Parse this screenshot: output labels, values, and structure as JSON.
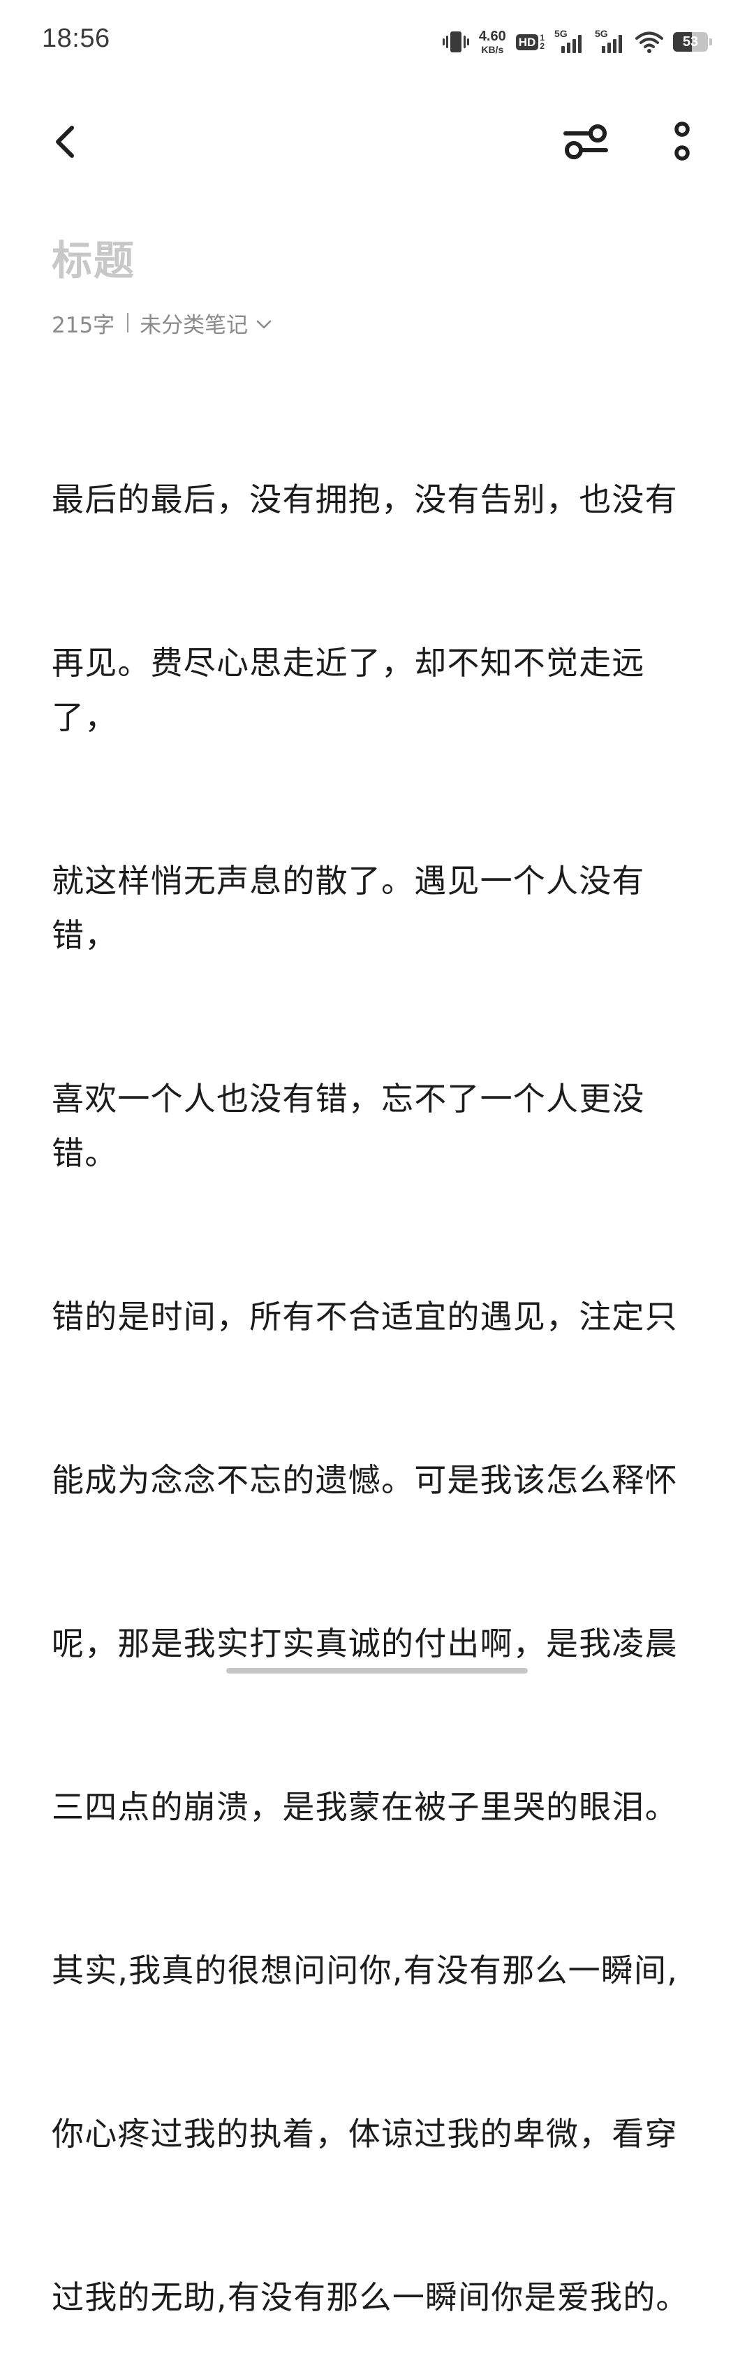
{
  "status_bar": {
    "time": "18:56",
    "net_speed_value": "4.60",
    "net_speed_unit": "KB/s",
    "hd_label": "HD",
    "sim1_label": "5G",
    "sim2_label": "5G",
    "battery_level": "53",
    "icons": [
      "vibrate-icon",
      "hd-voice-icon",
      "signal-icon",
      "signal-icon",
      "wifi-icon",
      "battery-icon"
    ]
  },
  "toolbar": {
    "icons": [
      "back-arrow-icon",
      "style-settings-icon",
      "more-vertical-icon"
    ]
  },
  "note": {
    "title_placeholder": "标题",
    "word_count": "215字",
    "category": "未分类笔记",
    "body_lines": [
      "最后的最后，没有拥抱，没有告别，也没有",
      "再见。费尽心思走近了，却不知不觉走远了，",
      "就这样悄无声息的散了。遇见一个人没有错，",
      "喜欢一个人也没有错，忘不了一个人更没错。",
      "错的是时间，所有不合适宜的遇见，注定只",
      "能成为念念不忘的遗憾。可是我该怎么释怀",
      "呢，那是我实打实真诚的付出啊，是我凌晨",
      "三四点的崩溃，是我蒙在被子里哭的眼泪。",
      "其实,我真的很想问问你,有没有那么一瞬间,",
      "你心疼过我的执着，体谅过我的卑微，看穿",
      "过我的无助,有没有那么一瞬间你是爱我的。"
    ]
  }
}
